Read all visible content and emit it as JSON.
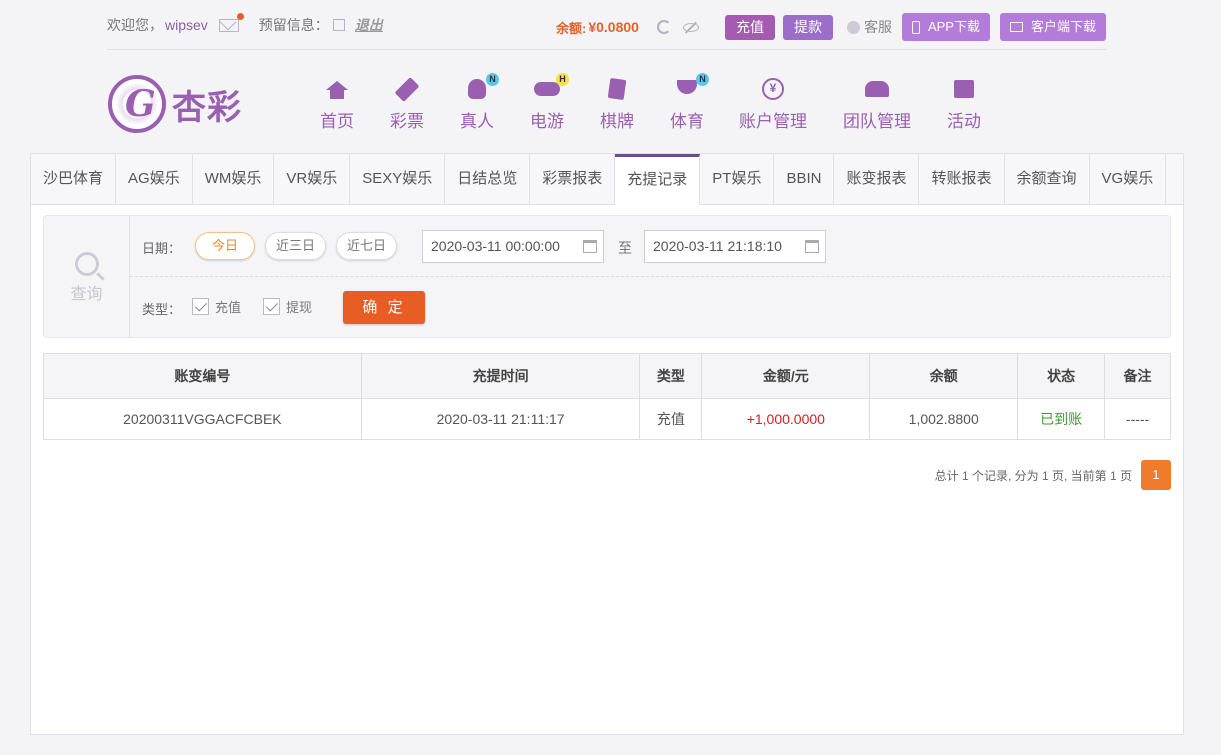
{
  "topbar": {
    "welcome": "欢迎您，",
    "username": "wipsev",
    "reserve_label": "预留信息：",
    "logout": "退出",
    "balance_label": "余额:",
    "balance_value": "¥0.0800",
    "charge_btn": "充值",
    "withdraw_btn": "提款",
    "service": "客服",
    "app_download": "APP下载",
    "client_download": "客户端下载"
  },
  "logo": {
    "text": "杏彩"
  },
  "nav": [
    {
      "label": "首页",
      "icon": "home-icon"
    },
    {
      "label": "彩票",
      "icon": "ticket-icon"
    },
    {
      "label": "真人",
      "icon": "dealer-icon",
      "badge": "N"
    },
    {
      "label": "电游",
      "icon": "gamepad-icon",
      "badge": "H"
    },
    {
      "label": "棋牌",
      "icon": "cards-icon"
    },
    {
      "label": "体育",
      "icon": "trophy-icon",
      "badge": "N"
    },
    {
      "label": "账户管理",
      "icon": "yen-coin-icon",
      "glyph": "¥"
    },
    {
      "label": "团队管理",
      "icon": "team-icon"
    },
    {
      "label": "活动",
      "icon": "gift-icon"
    }
  ],
  "tabs": [
    "沙巴体育",
    "AG娱乐",
    "WM娱乐",
    "VR娱乐",
    "SEXY娱乐",
    "日结总览",
    "彩票报表",
    "充提记录",
    "PT娱乐",
    "BBIN",
    "账变报表",
    "转账报表",
    "余额查询",
    "VG娱乐"
  ],
  "active_tab": "充提记录",
  "filter": {
    "query_label": "查询",
    "date_label": "日期：",
    "quick": [
      "今日",
      "近三日",
      "近七日"
    ],
    "start": "2020-03-11 00:00:00",
    "to": "至",
    "end": "2020-03-11 21:18:10",
    "type_label": "类型：",
    "types": [
      "充值",
      "提现"
    ],
    "confirm": "确 定"
  },
  "table": {
    "headers": [
      "账变编号",
      "充提时间",
      "类型",
      "金额/元",
      "余额",
      "状态",
      "备注"
    ],
    "rows": [
      [
        "20200311VGGACFCBEK",
        "2020-03-11 21:11:17",
        "充值",
        "+1,000.0000",
        "1,002.8800",
        "已到账",
        "-----"
      ]
    ]
  },
  "pager": {
    "summary": "总计 1 个记录, 分为 1 页, 当前第 1 页",
    "page": "1"
  },
  "colors": {
    "brand": "#9b5fb1",
    "accent": "#e85d23",
    "success": "#3a9a2c",
    "amount": "#d42020"
  }
}
